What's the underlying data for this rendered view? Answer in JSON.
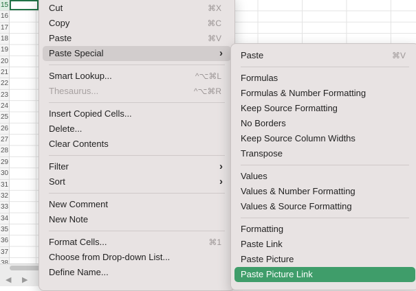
{
  "sheet": {
    "rows": [
      "15",
      "16",
      "17",
      "18",
      "19",
      "20",
      "21",
      "22",
      "23",
      "24",
      "25",
      "26",
      "27",
      "28",
      "29",
      "30",
      "31",
      "32",
      "33",
      "34",
      "35",
      "36",
      "37",
      "38"
    ],
    "active_row": "15"
  },
  "context_menu": {
    "groups": [
      [
        {
          "label": "Cut",
          "shortcut": "⌘X"
        },
        {
          "label": "Copy",
          "shortcut": "⌘C"
        },
        {
          "label": "Paste",
          "shortcut": "⌘V"
        },
        {
          "label": "Paste Special",
          "submenu": true,
          "highlighted": true
        }
      ],
      [
        {
          "label": "Smart Lookup...",
          "shortcut": "^⌥⌘L"
        },
        {
          "label": "Thesaurus...",
          "shortcut": "^⌥⌘R",
          "disabled": true
        }
      ],
      [
        {
          "label": "Insert Copied Cells..."
        },
        {
          "label": "Delete..."
        },
        {
          "label": "Clear Contents"
        }
      ],
      [
        {
          "label": "Filter",
          "submenu": true
        },
        {
          "label": "Sort",
          "submenu": true
        }
      ],
      [
        {
          "label": "New Comment"
        },
        {
          "label": "New Note"
        }
      ],
      [
        {
          "label": "Format Cells...",
          "shortcut": "⌘1"
        },
        {
          "label": "Choose from Drop-down List..."
        },
        {
          "label": "Define Name..."
        }
      ]
    ]
  },
  "paste_special_menu": {
    "groups": [
      [
        {
          "label": "Paste",
          "shortcut": "⌘V"
        }
      ],
      [
        {
          "label": "Formulas"
        },
        {
          "label": "Formulas & Number Formatting"
        },
        {
          "label": "Keep Source Formatting"
        },
        {
          "label": "No Borders"
        },
        {
          "label": "Keep Source Column Widths"
        },
        {
          "label": "Transpose"
        }
      ],
      [
        {
          "label": "Values"
        },
        {
          "label": "Values & Number Formatting"
        },
        {
          "label": "Values & Source Formatting"
        }
      ],
      [
        {
          "label": "Formatting"
        },
        {
          "label": "Paste Link"
        },
        {
          "label": "Paste Picture"
        },
        {
          "label": "Paste Picture Link",
          "highlighted": true
        }
      ]
    ]
  },
  "icons": {
    "submenu_chevron": "chevron-right-icon",
    "sheet_prev": "triangle-left-icon",
    "sheet_next": "triangle-right-icon"
  },
  "colors": {
    "menu_bg": "#e8e3e3",
    "hover_grey": "#d2cdcd",
    "selection_green": "#3f9d6a",
    "active_cell_border": "#217346"
  }
}
